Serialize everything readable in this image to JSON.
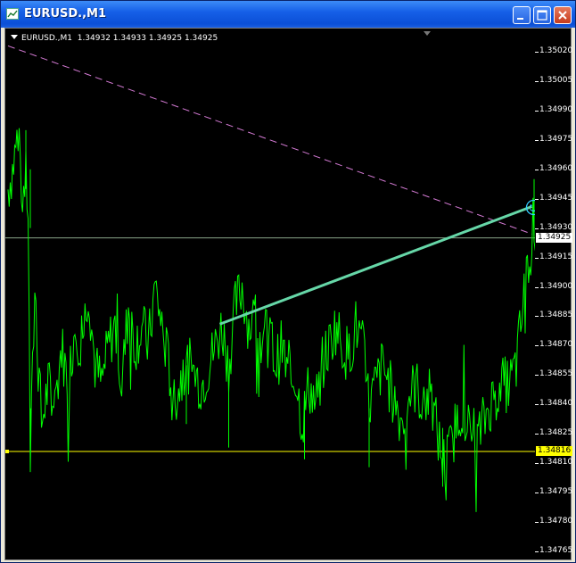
{
  "window": {
    "title": "EURUSD.,M1",
    "icons": [
      "chart-window-icon",
      "minimize-icon",
      "maximize-icon",
      "close-icon"
    ]
  },
  "chart_info": {
    "symbol_label": "EURUSD.,M1",
    "ohlc": "1.34932 1.34933 1.34925 1.34925"
  },
  "price_scale": {
    "ticks": [
      "1.35020",
      "1.35005",
      "1.34990",
      "1.34975",
      "1.34960",
      "1.34945",
      "1.34930",
      "1.34915",
      "1.34900",
      "1.34885",
      "1.34870",
      "1.34855",
      "1.34840",
      "1.34825",
      "1.34810",
      "1.34795",
      "1.34780",
      "1.34765"
    ],
    "bid_label": "1.34925",
    "hline_label": "1.34816"
  },
  "chart_data": {
    "type": "line",
    "symbol": "EURUSD.",
    "timeframe": "M1",
    "ylim": [
      1.34758,
      1.3503
    ],
    "bid": 1.34925,
    "horizontal_line": 1.34816,
    "trendline_start": {
      "bar_index": 190,
      "price": 1.34881
    },
    "trendline_end": {
      "bar_index": 470,
      "price": 1.34941
    },
    "dashed_trendline_start": {
      "bar_index": 0,
      "price": 1.35023
    },
    "dashed_trendline_end": {
      "bar_index": 470,
      "price": 1.34927
    },
    "anchors": [
      [
        0,
        1.3495
      ],
      [
        4,
        1.3496
      ],
      [
        8,
        1.34975
      ],
      [
        12,
        1.34945
      ],
      [
        16,
        1.34955
      ],
      [
        18,
        1.3494
      ],
      [
        20,
        1.3481
      ],
      [
        24,
        1.349
      ],
      [
        30,
        1.3483
      ],
      [
        36,
        1.3485
      ],
      [
        42,
        1.3484
      ],
      [
        48,
        1.3487
      ],
      [
        54,
        1.3485
      ],
      [
        60,
        1.3488
      ],
      [
        66,
        1.3487
      ],
      [
        72,
        1.349
      ],
      [
        78,
        1.3486
      ],
      [
        84,
        1.3485
      ],
      [
        90,
        1.3487
      ],
      [
        96,
        1.3488
      ],
      [
        102,
        1.3485
      ],
      [
        108,
        1.3489
      ],
      [
        114,
        1.3487
      ],
      [
        120,
        1.3488
      ],
      [
        126,
        1.3487
      ],
      [
        132,
        1.349
      ],
      [
        138,
        1.3488
      ],
      [
        144,
        1.3486
      ],
      [
        150,
        1.3484
      ],
      [
        156,
        1.34855
      ],
      [
        162,
        1.3486
      ],
      [
        168,
        1.34855
      ],
      [
        174,
        1.3485
      ],
      [
        180,
        1.3486
      ],
      [
        186,
        1.3487
      ],
      [
        192,
        1.3488
      ],
      [
        198,
        1.3486
      ],
      [
        204,
        1.3489
      ],
      [
        210,
        1.349
      ],
      [
        216,
        1.3488
      ],
      [
        222,
        1.34885
      ],
      [
        228,
        1.3487
      ],
      [
        234,
        1.3488
      ],
      [
        240,
        1.3486
      ],
      [
        246,
        1.3487
      ],
      [
        252,
        1.3485
      ],
      [
        258,
        1.34855
      ],
      [
        264,
        1.3483
      ],
      [
        270,
        1.3485
      ],
      [
        276,
        1.3484
      ],
      [
        282,
        1.3486
      ],
      [
        288,
        1.3487
      ],
      [
        294,
        1.3488
      ],
      [
        300,
        1.3487
      ],
      [
        306,
        1.34865
      ],
      [
        312,
        1.3488
      ],
      [
        318,
        1.3487
      ],
      [
        324,
        1.3484
      ],
      [
        330,
        1.3485
      ],
      [
        336,
        1.3486
      ],
      [
        342,
        1.3485
      ],
      [
        348,
        1.3484
      ],
      [
        354,
        1.3483
      ],
      [
        360,
        1.34845
      ],
      [
        366,
        1.3485
      ],
      [
        372,
        1.3484
      ],
      [
        378,
        1.34845
      ],
      [
        384,
        1.3483
      ],
      [
        390,
        1.3481
      ],
      [
        396,
        1.34815
      ],
      [
        402,
        1.3483
      ],
      [
        408,
        1.3484
      ],
      [
        414,
        1.34825
      ],
      [
        420,
        1.3482
      ],
      [
        426,
        1.3483
      ],
      [
        432,
        1.3484
      ],
      [
        438,
        1.34845
      ],
      [
        444,
        1.3485
      ],
      [
        450,
        1.3485
      ],
      [
        456,
        1.3486
      ],
      [
        460,
        1.3488
      ],
      [
        464,
        1.349
      ],
      [
        468,
        1.3492
      ],
      [
        472,
        1.34935
      ],
      [
        474,
        1.34925
      ]
    ],
    "bar_count": 475
  },
  "colors": {
    "price_line": "#00ff00",
    "trendline": "#66d7a8",
    "dashed_trendline": "#d47ad4",
    "bid_line": "#8aa58a",
    "horizontal_line": "#ffff00",
    "smiley": "#33ccff"
  }
}
